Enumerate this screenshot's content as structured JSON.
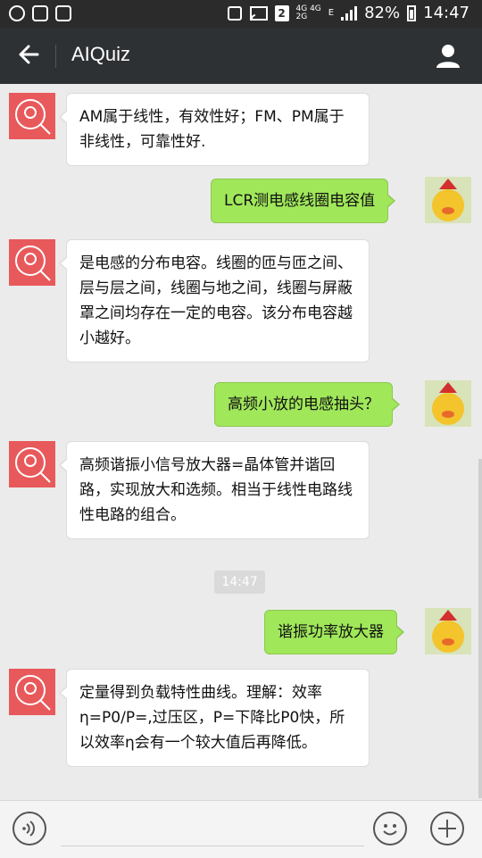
{
  "status_bar": {
    "sim_label": "2",
    "network_top": "4G 4G",
    "network_bottom": "2G",
    "signal_label": "E",
    "battery": "82%",
    "time": "14:47"
  },
  "app_bar": {
    "title": "AIQuiz"
  },
  "messages": [
    {
      "side": "in",
      "text": "AM属于线性，有效性好；FM、PM属于非线性，可靠性好."
    },
    {
      "side": "out",
      "text": "LCR测电感线圈电容值"
    },
    {
      "side": "in",
      "text": "是电感的分布电容。线圈的匝与匝之间、层与层之间，线圈与地之间，线圈与屏蔽罩之间均存在一定的电容。该分布电容越小越好。"
    },
    {
      "side": "out",
      "text": "高频小放的电感抽头？"
    },
    {
      "side": "in",
      "text": "高频谐振小信号放大器=晶体管并谐回路，实现放大和选频。相当于线性电路线性电路的组合。"
    },
    {
      "side": "out",
      "text": "谐振功率放大器"
    },
    {
      "side": "in",
      "text": "定量得到负载特性曲线。理解：效率η=P0/P=,过压区，P=下降比P0快，所以效率η会有一个较大值后再降低。"
    }
  ],
  "timestamp": "14:47",
  "colors": {
    "header": "#2e3134",
    "outgoing_bubble": "#a0e75a",
    "bot_avatar": "#e8595b"
  }
}
